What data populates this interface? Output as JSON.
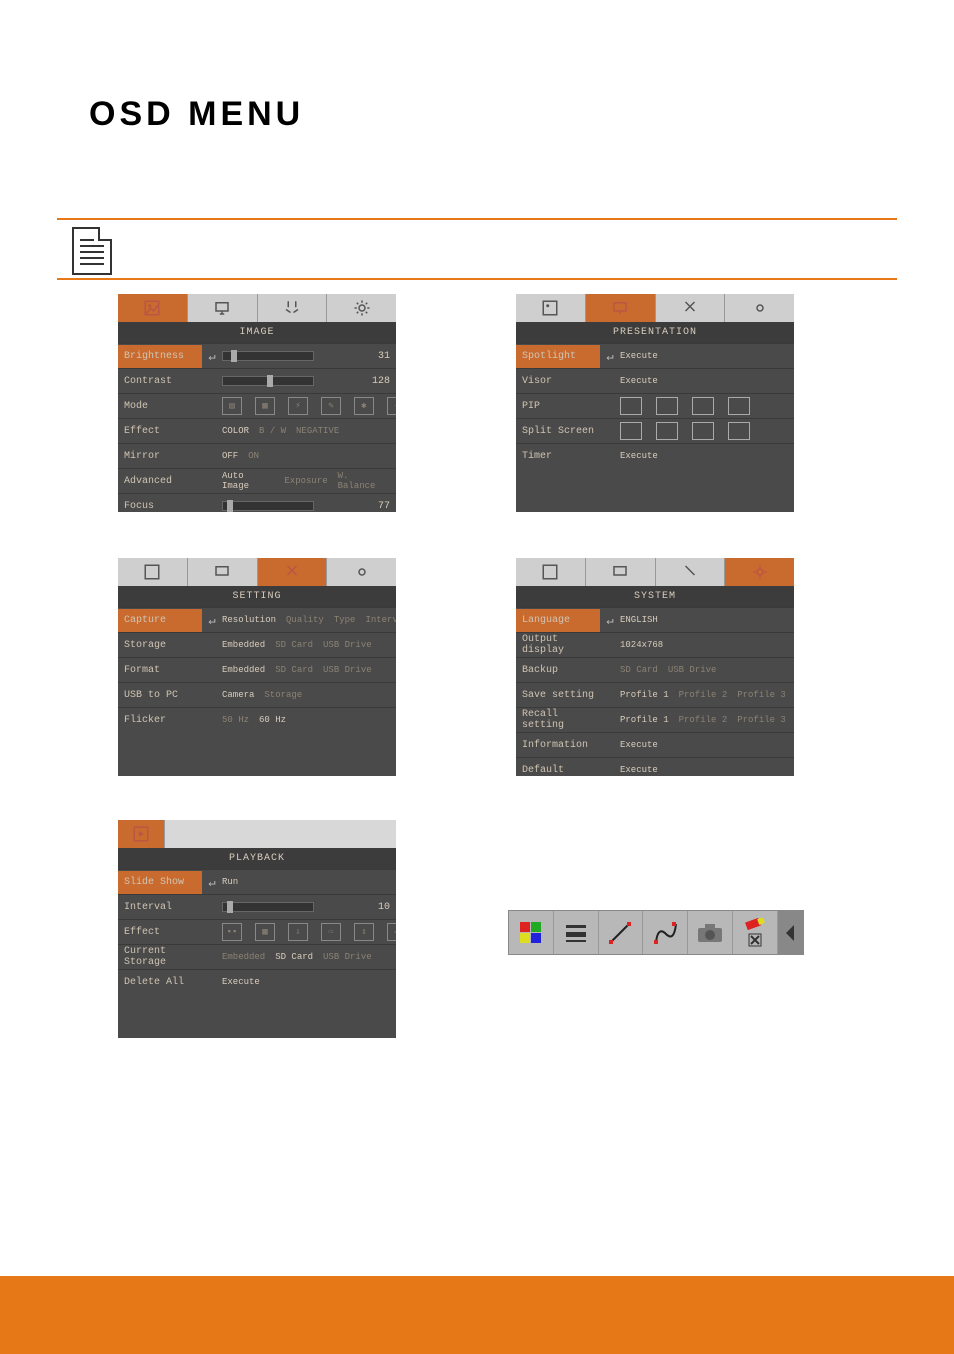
{
  "page_title": "OSD MENU",
  "panels": {
    "image": {
      "title": "IMAGE",
      "rows": {
        "brightness": {
          "label": "Brightness",
          "value": "31"
        },
        "contrast": {
          "label": "Contrast",
          "value": "128"
        },
        "mode": {
          "label": "Mode"
        },
        "effect": {
          "label": "Effect",
          "opts": [
            "COLOR",
            "B / W",
            "NEGATIVE"
          ]
        },
        "mirror": {
          "label": "Mirror",
          "opts": [
            "OFF",
            "ON"
          ]
        },
        "advanced": {
          "label": "Advanced",
          "opts": [
            "Auto Image",
            "Exposure",
            "W. Balance"
          ]
        },
        "focus": {
          "label": "Focus",
          "value": "77"
        }
      }
    },
    "presentation": {
      "title": "PRESENTATION",
      "rows": {
        "spotlight": {
          "label": "Spotlight",
          "value": "Execute"
        },
        "visor": {
          "label": "Visor",
          "value": "Execute"
        },
        "pip": {
          "label": "PIP"
        },
        "split": {
          "label": "Split Screen"
        },
        "timer": {
          "label": "Timer",
          "value": "Execute"
        }
      }
    },
    "setting": {
      "title": "SETTING",
      "rows": {
        "capture": {
          "label": "Capture",
          "opts": [
            "Resolution",
            "Quality",
            "Type",
            "Interval"
          ]
        },
        "storage": {
          "label": "Storage",
          "opts": [
            "Embedded",
            "SD Card",
            "USB Drive"
          ]
        },
        "format": {
          "label": "Format",
          "opts": [
            "Embedded",
            "SD Card",
            "USB Drive"
          ]
        },
        "usbpc": {
          "label": "USB to PC",
          "opts": [
            "Camera",
            "Storage"
          ]
        },
        "flicker": {
          "label": "Flicker",
          "opts": [
            "50 Hz",
            "60 Hz"
          ]
        }
      }
    },
    "system": {
      "title": "SYSTEM",
      "rows": {
        "language": {
          "label": "Language",
          "value": "ENGLISH"
        },
        "output": {
          "label": "Output display",
          "value": "1024x768"
        },
        "backup": {
          "label": "Backup",
          "opts": [
            "SD Card",
            "USB Drive"
          ]
        },
        "save": {
          "label": "Save setting",
          "opts": [
            "Profile 1",
            "Profile 2",
            "Profile 3"
          ]
        },
        "recall": {
          "label": "Recall setting",
          "opts": [
            "Profile 1",
            "Profile 2",
            "Profile 3"
          ]
        },
        "info": {
          "label": "Information",
          "value": "Execute"
        },
        "default": {
          "label": "Default",
          "value": "Execute"
        }
      }
    },
    "playback": {
      "title": "PLAYBACK",
      "rows": {
        "slideshow": {
          "label": "Slide Show",
          "value": "Run"
        },
        "interval": {
          "label": "Interval",
          "value": "10"
        },
        "effect": {
          "label": "Effect"
        },
        "storage": {
          "label": "Current Storage",
          "opts": [
            "Embedded",
            "SD Card",
            "USB Drive"
          ]
        },
        "delete": {
          "label": "Delete All",
          "value": "Execute"
        }
      }
    }
  },
  "toolbar_items": [
    "color-swatch",
    "lines",
    "line-tool",
    "curve-tool",
    "camera",
    "eraser",
    "arrow-left"
  ]
}
